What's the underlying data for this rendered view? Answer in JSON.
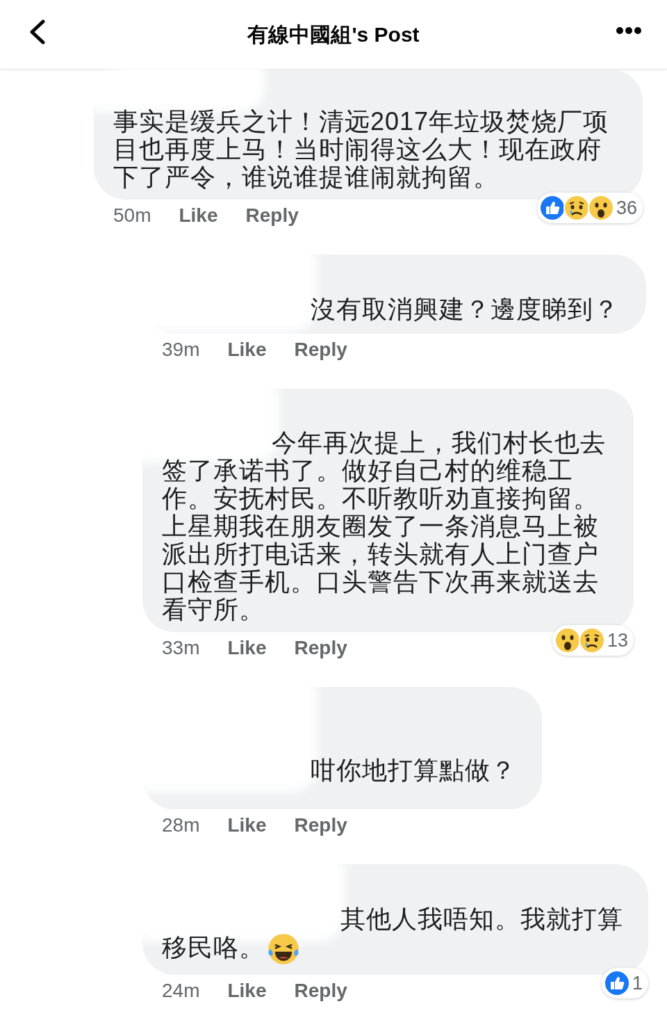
{
  "header": {
    "title": "有線中國組's Post"
  },
  "comments": [
    {
      "kind": "top",
      "name_hidden": true,
      "text": "事实是缓兵之计！清远2017年垃圾焚烧厂项目也再度上马！当时闹得这么大！现在政府下了严令，谁说谁提谁闹就拘留。",
      "time": "50m",
      "actions": [
        "Like",
        "Reply"
      ],
      "reactions": {
        "types": [
          {
            "kind": "like"
          },
          {
            "kind": "sad"
          },
          {
            "kind": "wow"
          }
        ],
        "count": "36"
      }
    },
    {
      "kind": "reply",
      "name_hidden": true,
      "text": "沒有取消興建？邊度睇到？",
      "time": "39m",
      "actions": [
        "Like",
        "Reply"
      ]
    },
    {
      "kind": "reply",
      "name_hidden": true,
      "text": "今年再次提上，我们村长也去签了承诺书了。做好自己村的维稳工作。安抚村民。不听教听劝直接拘留。上星期我在朋友圈发了一条消息马上被派出所打电话来，转头就有人上门查户口检查手机。口头警告下次再来就送去看守所。",
      "time": "33m",
      "actions": [
        "Like",
        "Reply"
      ],
      "reactions": {
        "types": [
          {
            "kind": "wow"
          },
          {
            "kind": "sad"
          }
        ],
        "count": "13"
      }
    },
    {
      "kind": "reply",
      "name_hidden": true,
      "text": "咁你地打算點做？",
      "time": "28m",
      "actions": [
        "Like",
        "Reply"
      ]
    },
    {
      "kind": "reply",
      "name_hidden": true,
      "text": "其他人我唔知。我就打算移民咯。",
      "emoji": [
        {
          "kind": "haha"
        }
      ],
      "time": "24m",
      "actions": [
        "Like",
        "Reply"
      ],
      "reactions": {
        "types": [
          {
            "kind": "like"
          }
        ],
        "count": "1"
      }
    }
  ]
}
